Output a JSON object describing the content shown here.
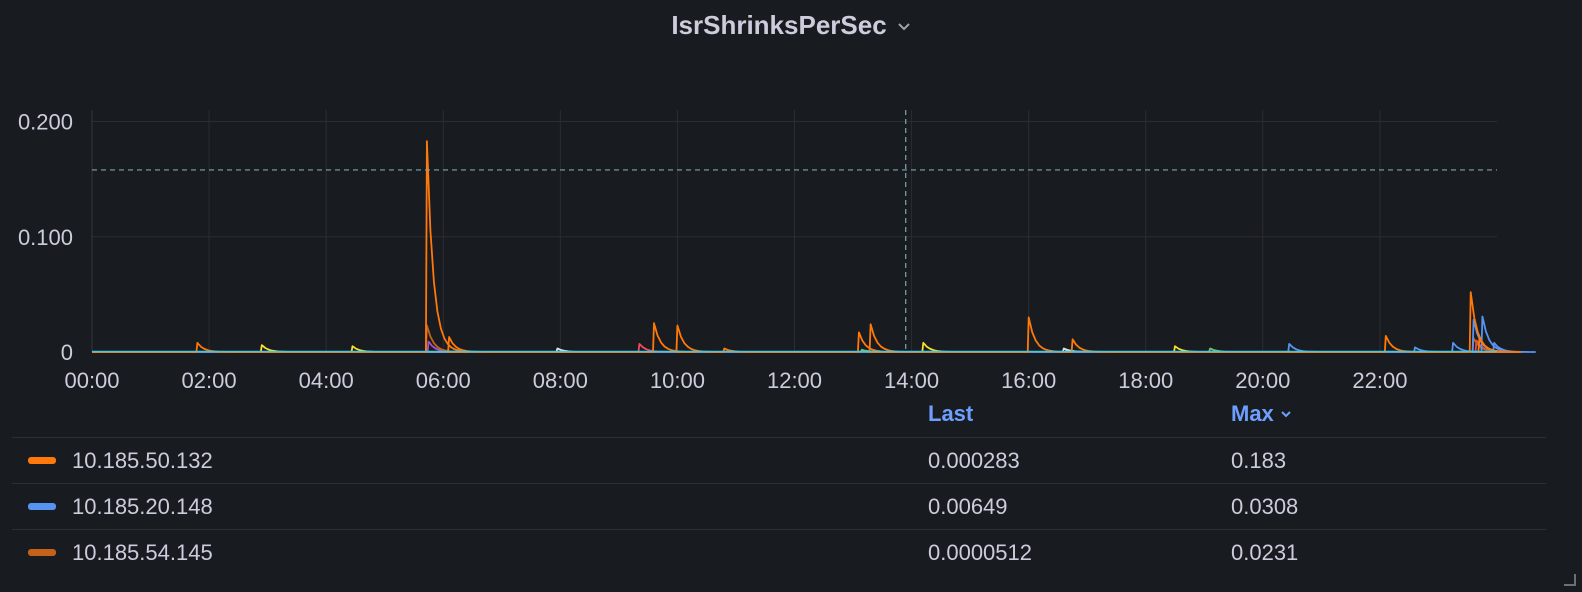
{
  "panel": {
    "title": "IsrShrinksPerSec"
  },
  "legend": {
    "headers": {
      "last": "Last",
      "max": "Max"
    },
    "rows": [
      {
        "name": "10.185.50.132",
        "color": "#ff780a",
        "last": "0.000283",
        "max": "0.183"
      },
      {
        "name": "10.185.20.148",
        "color": "#5794f2",
        "last": "0.00649",
        "max": "0.0308"
      },
      {
        "name": "10.185.54.145",
        "color": "#c4621a",
        "last": "0.0000512",
        "max": "0.0231"
      }
    ]
  },
  "chart_data": {
    "type": "line",
    "title": "IsrShrinksPerSec",
    "xlabel": "",
    "ylabel": "",
    "xlim": [
      0,
      24
    ],
    "ylim": [
      0,
      0.21
    ],
    "x_ticks": [
      "00:00",
      "02:00",
      "04:00",
      "06:00",
      "08:00",
      "10:00",
      "12:00",
      "14:00",
      "16:00",
      "18:00",
      "20:00",
      "22:00"
    ],
    "y_ticks": [
      {
        "v": 0,
        "label": "0"
      },
      {
        "v": 0.1,
        "label": "0.100"
      },
      {
        "v": 0.2,
        "label": "0.200"
      }
    ],
    "threshold": 0.158,
    "crosshair_x": 13.9,
    "grid": true,
    "legend_position": "bottom",
    "series": [
      {
        "name": "10.185.50.132",
        "color": "#ff780a",
        "spikes": [
          [
            1.8,
            0.008
          ],
          [
            5.72,
            0.183
          ],
          [
            6.1,
            0.013
          ],
          [
            9.6,
            0.025
          ],
          [
            10.0,
            0.023
          ],
          [
            10.8,
            0.003
          ],
          [
            13.1,
            0.017
          ],
          [
            13.3,
            0.024
          ],
          [
            16.0,
            0.03
          ],
          [
            16.75,
            0.011
          ],
          [
            22.1,
            0.014
          ],
          [
            23.55,
            0.052
          ],
          [
            23.7,
            0.012
          ]
        ]
      },
      {
        "name": "10.185.20.148",
        "color": "#5794f2",
        "spikes": [
          [
            20.45,
            0.007
          ],
          [
            22.6,
            0.004
          ],
          [
            23.25,
            0.008
          ],
          [
            23.6,
            0.028
          ],
          [
            23.75,
            0.0308
          ],
          [
            23.95,
            0.008
          ]
        ]
      },
      {
        "name": "10.185.54.145",
        "color": "#c4621a",
        "spikes": [
          [
            5.72,
            0.0231
          ],
          [
            23.6,
            0.012
          ]
        ]
      },
      {
        "name": "",
        "color": "#fade2a",
        "spikes": [
          [
            2.9,
            0.006
          ],
          [
            4.45,
            0.005
          ],
          [
            14.2,
            0.008
          ],
          [
            18.5,
            0.005
          ]
        ]
      },
      {
        "name": "",
        "color": "#f2495c",
        "spikes": [
          [
            9.35,
            0.007
          ],
          [
            23.65,
            0.01
          ]
        ]
      },
      {
        "name": "",
        "color": "#a352cc",
        "spikes": [
          [
            5.75,
            0.009
          ]
        ]
      },
      {
        "name": "",
        "color": "#73bf69",
        "spikes": [
          [
            19.1,
            0.003
          ],
          [
            13.15,
            0.002
          ]
        ]
      },
      {
        "name": "",
        "color": "#e0e0e0",
        "spikes": [
          [
            7.95,
            0.003
          ],
          [
            16.6,
            0.003
          ]
        ]
      },
      {
        "name": "",
        "color": "#8ab8ff",
        "spikes": [
          [
            16.65,
            0.002
          ]
        ]
      }
    ]
  }
}
